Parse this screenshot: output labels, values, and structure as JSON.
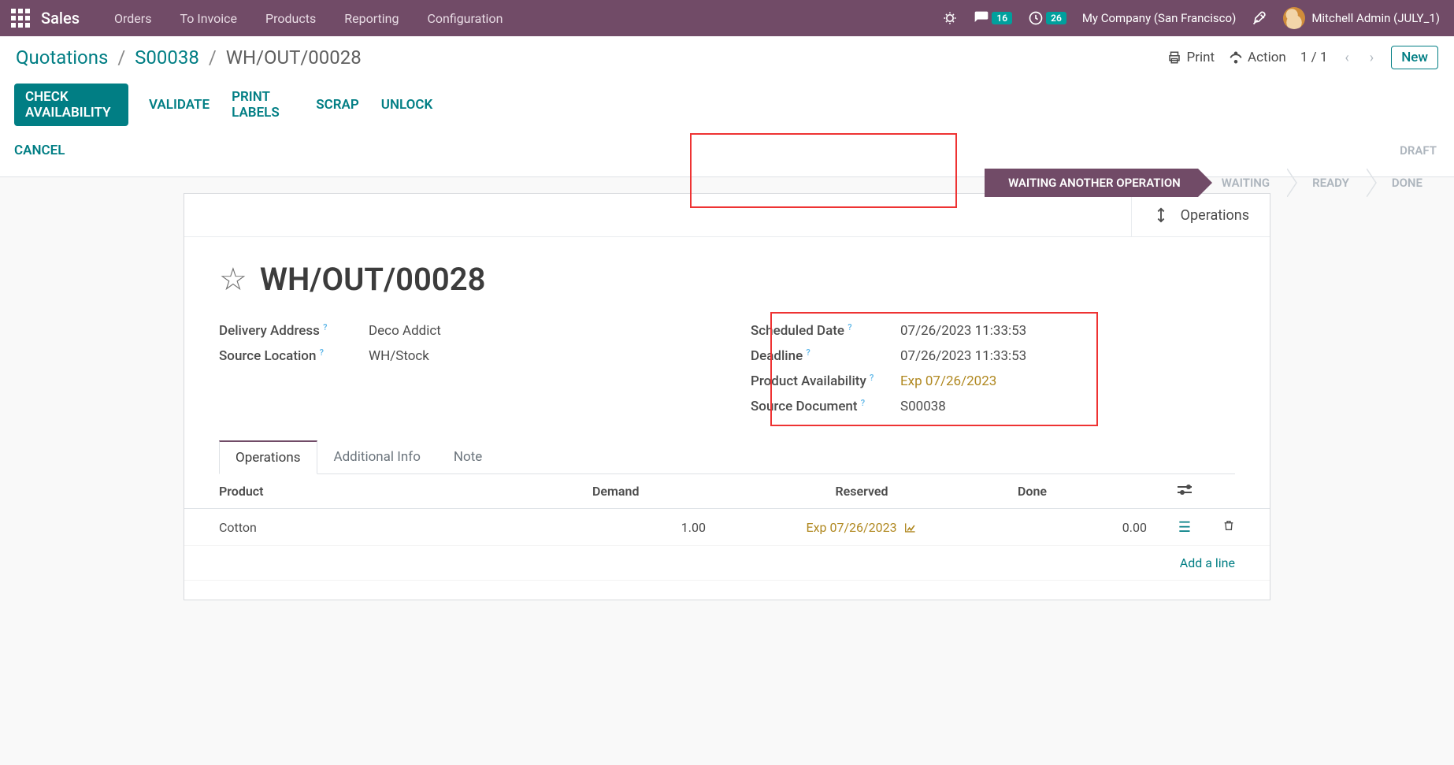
{
  "topnav": {
    "brand": "Sales",
    "menu": [
      "Orders",
      "To Invoice",
      "Products",
      "Reporting",
      "Configuration"
    ],
    "chat_badge": "16",
    "activity_badge": "26",
    "company": "My Company (San Francisco)",
    "user": "Mitchell Admin (JULY_1)"
  },
  "breadcrumb": {
    "root": "Quotations",
    "parent": "S00038",
    "current": "WH/OUT/00028"
  },
  "cp": {
    "print": "Print",
    "action": "Action",
    "pager": "1 / 1",
    "new": "New"
  },
  "actions": {
    "check_availability": "CHECK AVAILABILITY",
    "validate": "VALIDATE",
    "print_labels": "PRINT LABELS",
    "scrap": "SCRAP",
    "unlock": "UNLOCK",
    "cancel": "CANCEL"
  },
  "status": {
    "draft": "DRAFT",
    "steps": [
      "WAITING ANOTHER OPERATION",
      "WAITING",
      "READY",
      "DONE"
    ]
  },
  "stat_button": {
    "label": "Operations"
  },
  "record": {
    "title": "WH/OUT/00028",
    "labels": {
      "delivery_address": "Delivery Address",
      "source_location": "Source Location",
      "scheduled_date": "Scheduled Date",
      "deadline": "Deadline",
      "product_availability": "Product Availability",
      "source_document": "Source Document"
    },
    "values": {
      "delivery_address": "Deco Addict",
      "source_location": "WH/Stock",
      "scheduled_date": "07/26/2023 11:33:53",
      "deadline": "07/26/2023 11:33:53",
      "product_availability": "Exp 07/26/2023",
      "source_document": "S00038"
    }
  },
  "tabs": {
    "operations": "Operations",
    "additional": "Additional Info",
    "note": "Note"
  },
  "table": {
    "headers": {
      "product": "Product",
      "demand": "Demand",
      "reserved": "Reserved",
      "done": "Done"
    },
    "rows": [
      {
        "product": "Cotton",
        "demand": "1.00",
        "reserved": "Exp 07/26/2023",
        "done": "0.00"
      }
    ],
    "add_line": "Add a line"
  }
}
